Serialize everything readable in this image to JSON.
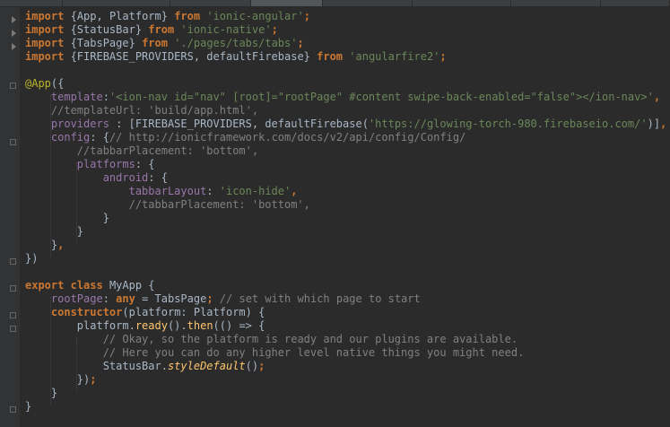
{
  "editor": {
    "lines": [
      {
        "tokens": [
          {
            "t": "import",
            "c": "kw"
          },
          {
            "t": " {",
            "c": ""
          },
          {
            "t": "App",
            "c": ""
          },
          {
            "t": ", ",
            "c": ""
          },
          {
            "t": "Platform",
            "c": ""
          },
          {
            "t": "} ",
            "c": ""
          },
          {
            "t": "from",
            "c": "kw"
          },
          {
            "t": " ",
            "c": ""
          },
          {
            "t": "'ionic-angular'",
            "c": "str"
          },
          {
            "t": ";",
            "c": "kw"
          }
        ]
      },
      {
        "tokens": [
          {
            "t": "import",
            "c": "kw"
          },
          {
            "t": " {StatusBar} ",
            "c": ""
          },
          {
            "t": "from",
            "c": "kw"
          },
          {
            "t": " ",
            "c": ""
          },
          {
            "t": "'ionic-native'",
            "c": "str"
          },
          {
            "t": ";",
            "c": "kw"
          }
        ]
      },
      {
        "tokens": [
          {
            "t": "import",
            "c": "kw"
          },
          {
            "t": " {TabsPage} ",
            "c": ""
          },
          {
            "t": "from",
            "c": "kw"
          },
          {
            "t": " ",
            "c": ""
          },
          {
            "t": "'./pages/tabs/tabs'",
            "c": "str"
          },
          {
            "t": ";",
            "c": "kw"
          }
        ]
      },
      {
        "tokens": [
          {
            "t": "import",
            "c": "kw"
          },
          {
            "t": " {FIREBASE_PROVIDERS, defaultFirebase} ",
            "c": ""
          },
          {
            "t": "from",
            "c": "kw"
          },
          {
            "t": " ",
            "c": ""
          },
          {
            "t": "'angularfire2'",
            "c": "str"
          },
          {
            "t": ";",
            "c": "kw"
          }
        ]
      },
      {
        "tokens": []
      },
      {
        "tokens": [
          {
            "t": "@App",
            "c": "dec"
          },
          {
            "t": "({",
            "c": ""
          }
        ]
      },
      {
        "tokens": [
          {
            "t": "    ",
            "c": ""
          },
          {
            "t": "template",
            "c": "prop"
          },
          {
            "t": ":",
            "c": ""
          },
          {
            "t": "'<ion-nav id=\"nav\" [root]=\"rootPage\" #content swipe-back-enabled=\"false\"></ion-nav>'",
            "c": "str"
          },
          {
            "t": ",",
            "c": "kw"
          }
        ]
      },
      {
        "tokens": [
          {
            "t": "    ",
            "c": ""
          },
          {
            "t": "//templateUrl: 'build/app.html',",
            "c": "cm"
          }
        ]
      },
      {
        "tokens": [
          {
            "t": "    ",
            "c": ""
          },
          {
            "t": "providers",
            "c": "prop"
          },
          {
            "t": " : [FIREBASE_PROVIDERS, defaultFirebase(",
            "c": ""
          },
          {
            "t": "'https://glowing-torch-980.firebaseio.com/'",
            "c": "str"
          },
          {
            "t": ")]",
            "c": ""
          },
          {
            "t": ",",
            "c": "kw"
          }
        ]
      },
      {
        "tokens": [
          {
            "t": "    ",
            "c": ""
          },
          {
            "t": "config",
            "c": "prop"
          },
          {
            "t": ": {",
            "c": ""
          },
          {
            "t": "// http://ionicframework.com/docs/v2/api/config/Config/",
            "c": "cm"
          }
        ]
      },
      {
        "tokens": [
          {
            "t": "        ",
            "c": ""
          },
          {
            "t": "//tabbarPlacement: 'bottom',",
            "c": "cm"
          }
        ]
      },
      {
        "tokens": [
          {
            "t": "        ",
            "c": ""
          },
          {
            "t": "platforms",
            "c": "prop"
          },
          {
            "t": ": {",
            "c": ""
          }
        ]
      },
      {
        "tokens": [
          {
            "t": "            ",
            "c": ""
          },
          {
            "t": "android",
            "c": "prop"
          },
          {
            "t": ": {",
            "c": ""
          }
        ]
      },
      {
        "tokens": [
          {
            "t": "                ",
            "c": ""
          },
          {
            "t": "tabbarLayout",
            "c": "prop"
          },
          {
            "t": ": ",
            "c": ""
          },
          {
            "t": "'icon-hide'",
            "c": "str"
          },
          {
            "t": ",",
            "c": "kw"
          }
        ]
      },
      {
        "tokens": [
          {
            "t": "                ",
            "c": ""
          },
          {
            "t": "//tabbarPlacement: 'bottom',",
            "c": "cm"
          }
        ]
      },
      {
        "tokens": [
          {
            "t": "            }",
            "c": ""
          }
        ]
      },
      {
        "tokens": [
          {
            "t": "        }",
            "c": ""
          }
        ]
      },
      {
        "tokens": [
          {
            "t": "    }",
            "c": ""
          },
          {
            "t": ",",
            "c": "kw"
          }
        ]
      },
      {
        "tokens": [
          {
            "t": "})",
            "c": ""
          }
        ]
      },
      {
        "tokens": []
      },
      {
        "tokens": [
          {
            "t": "export",
            "c": "kw"
          },
          {
            "t": " ",
            "c": ""
          },
          {
            "t": "class",
            "c": "kw"
          },
          {
            "t": " MyApp {",
            "c": ""
          }
        ]
      },
      {
        "tokens": [
          {
            "t": "    ",
            "c": ""
          },
          {
            "t": "rootPage",
            "c": "prop"
          },
          {
            "t": ": ",
            "c": ""
          },
          {
            "t": "any",
            "c": "kw"
          },
          {
            "t": " = TabsPage",
            "c": ""
          },
          {
            "t": ";",
            "c": "kw"
          },
          {
            "t": " ",
            "c": ""
          },
          {
            "t": "// set with which page to start",
            "c": "cm"
          }
        ]
      },
      {
        "tokens": [
          {
            "t": "    ",
            "c": ""
          },
          {
            "t": "constructor",
            "c": "kw"
          },
          {
            "t": "(platform: Platform) {",
            "c": ""
          }
        ]
      },
      {
        "tokens": [
          {
            "t": "        platform.",
            "c": ""
          },
          {
            "t": "ready",
            "c": "fn"
          },
          {
            "t": "().",
            "c": ""
          },
          {
            "t": "then",
            "c": "fn"
          },
          {
            "t": "(() => {",
            "c": ""
          }
        ]
      },
      {
        "tokens": [
          {
            "t": "            ",
            "c": ""
          },
          {
            "t": "// Okay, so the platform is ready and our plugins are available.",
            "c": "cm"
          }
        ]
      },
      {
        "tokens": [
          {
            "t": "            ",
            "c": ""
          },
          {
            "t": "// Here you can do any higher level native things you might need.",
            "c": "cm"
          }
        ]
      },
      {
        "tokens": [
          {
            "t": "            StatusBar.",
            "c": ""
          },
          {
            "t": "styleDefault",
            "c": "fn it"
          },
          {
            "t": "()",
            "c": ""
          },
          {
            "t": ";",
            "c": "kw"
          }
        ]
      },
      {
        "tokens": [
          {
            "t": "        })",
            "c": ""
          },
          {
            "t": ";",
            "c": "kw"
          }
        ]
      },
      {
        "tokens": [
          {
            "t": "    }",
            "c": ""
          }
        ]
      },
      {
        "tokens": [
          {
            "t": "}",
            "c": ""
          }
        ]
      }
    ]
  }
}
